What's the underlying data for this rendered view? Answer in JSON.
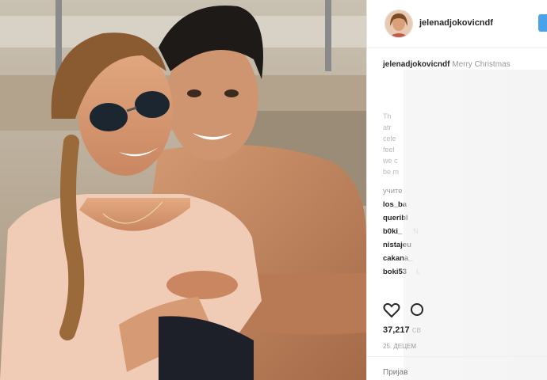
{
  "post": {
    "username": "jelenadjokovicndf",
    "caption_user": "jelenadjokovicndf",
    "caption_text": "Merry Christmas",
    "blurred_lines": [
      "Th",
      "atr",
      "cele",
      "feel",
      "we c",
      "be m"
    ],
    "comments": [
      {
        "user": "учите"
      },
      {
        "user": "los_ba"
      },
      {
        "user": "queribl"
      },
      {
        "user": "b0ki_",
        "text": "N"
      },
      {
        "user": "nistajeu"
      },
      {
        "user": "cakana_"
      },
      {
        "user": "boki53",
        "text": "L"
      }
    ],
    "likes": "37,217",
    "likes_suffix": "св",
    "date": "25. ДЕЦЕМ",
    "login": "Пријав"
  },
  "colors": {
    "accent": "#4aa3ea",
    "text": "#262626"
  },
  "icons": [
    "heart-icon",
    "comment-icon",
    "avatar"
  ]
}
